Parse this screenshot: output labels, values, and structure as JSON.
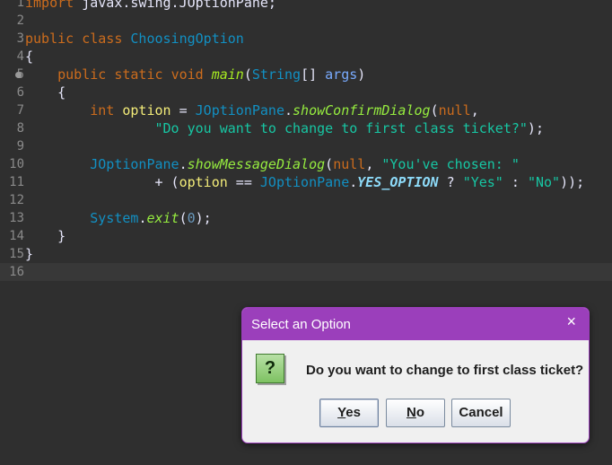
{
  "editor": {
    "lines": [
      {
        "n": "1",
        "t": [
          [
            "kw",
            "import"
          ],
          [
            "txt",
            " javax.swing.JOptionPane;"
          ]
        ]
      },
      {
        "n": "2",
        "t": []
      },
      {
        "n": "3",
        "t": [
          [
            "kw",
            "public"
          ],
          [
            "txt",
            " "
          ],
          [
            "kw",
            "class"
          ],
          [
            "txt",
            " "
          ],
          [
            "type",
            "ChoosingOption"
          ]
        ]
      },
      {
        "n": "4",
        "t": [
          [
            "txt",
            "{"
          ]
        ]
      },
      {
        "n": "5",
        "fold": true,
        "t": [
          [
            "txt",
            "    "
          ],
          [
            "kw",
            "public"
          ],
          [
            "txt",
            " "
          ],
          [
            "kw",
            "static"
          ],
          [
            "txt",
            " "
          ],
          [
            "kw",
            "void"
          ],
          [
            "txt",
            " "
          ],
          [
            "meth",
            "main"
          ],
          [
            "txt",
            "("
          ],
          [
            "type",
            "String"
          ],
          [
            "txt",
            "[] "
          ],
          [
            "param",
            "args"
          ],
          [
            "txt",
            ")"
          ]
        ]
      },
      {
        "n": "6",
        "t": [
          [
            "txt",
            "    {"
          ]
        ]
      },
      {
        "n": "7",
        "t": [
          [
            "txt",
            "        "
          ],
          [
            "kw",
            "int"
          ],
          [
            "txt",
            " "
          ],
          [
            "var",
            "option"
          ],
          [
            "txt",
            " = "
          ],
          [
            "type",
            "JOptionPane"
          ],
          [
            "txt",
            "."
          ],
          [
            "smeth",
            "showConfirmDialog"
          ],
          [
            "txt",
            "("
          ],
          [
            "kw",
            "null"
          ],
          [
            "txt",
            ","
          ]
        ]
      },
      {
        "n": "8",
        "t": [
          [
            "txt",
            "                "
          ],
          [
            "str",
            "\"Do you want to change to first class ticket?\""
          ],
          [
            "txt",
            ");"
          ]
        ]
      },
      {
        "n": "9",
        "t": []
      },
      {
        "n": "10",
        "t": [
          [
            "txt",
            "        "
          ],
          [
            "type",
            "JOptionPane"
          ],
          [
            "txt",
            "."
          ],
          [
            "smeth",
            "showMessageDialog"
          ],
          [
            "txt",
            "("
          ],
          [
            "kw",
            "null"
          ],
          [
            "txt",
            ", "
          ],
          [
            "str",
            "\"You've chosen: \""
          ]
        ]
      },
      {
        "n": "11",
        "t": [
          [
            "txt",
            "                + ("
          ],
          [
            "var",
            "option"
          ],
          [
            "txt",
            " == "
          ],
          [
            "type",
            "JOptionPane"
          ],
          [
            "txt",
            "."
          ],
          [
            "const",
            "YES_OPTION"
          ],
          [
            "txt",
            " ? "
          ],
          [
            "str",
            "\"Yes\""
          ],
          [
            "txt",
            " : "
          ],
          [
            "str",
            "\"No\""
          ],
          [
            "txt",
            "));"
          ]
        ]
      },
      {
        "n": "12",
        "t": []
      },
      {
        "n": "13",
        "t": [
          [
            "txt",
            "        "
          ],
          [
            "type",
            "System"
          ],
          [
            "txt",
            "."
          ],
          [
            "smeth",
            "exit"
          ],
          [
            "txt",
            "("
          ],
          [
            "num",
            "0"
          ],
          [
            "txt",
            ");"
          ]
        ]
      },
      {
        "n": "14",
        "t": [
          [
            "txt",
            "    }"
          ]
        ]
      },
      {
        "n": "15",
        "t": [
          [
            "txt",
            "}"
          ]
        ]
      },
      {
        "n": "16",
        "current": true,
        "t": []
      }
    ]
  },
  "dialog": {
    "title": "Select an Option",
    "close_icon": "×",
    "icon": "?",
    "message": "Do you want to change to first class ticket?",
    "buttons": {
      "yes": {
        "mnemonic": "Y",
        "rest": "es"
      },
      "no": {
        "mnemonic": "N",
        "rest": "o"
      },
      "cancel": "Cancel"
    }
  },
  "colors": {
    "editor_bg": "#2f2f2f",
    "dialog_accent": "#9b3fbb",
    "keyword": "#cc6c1d",
    "string": "#17c6a3",
    "type": "#1290c3"
  }
}
